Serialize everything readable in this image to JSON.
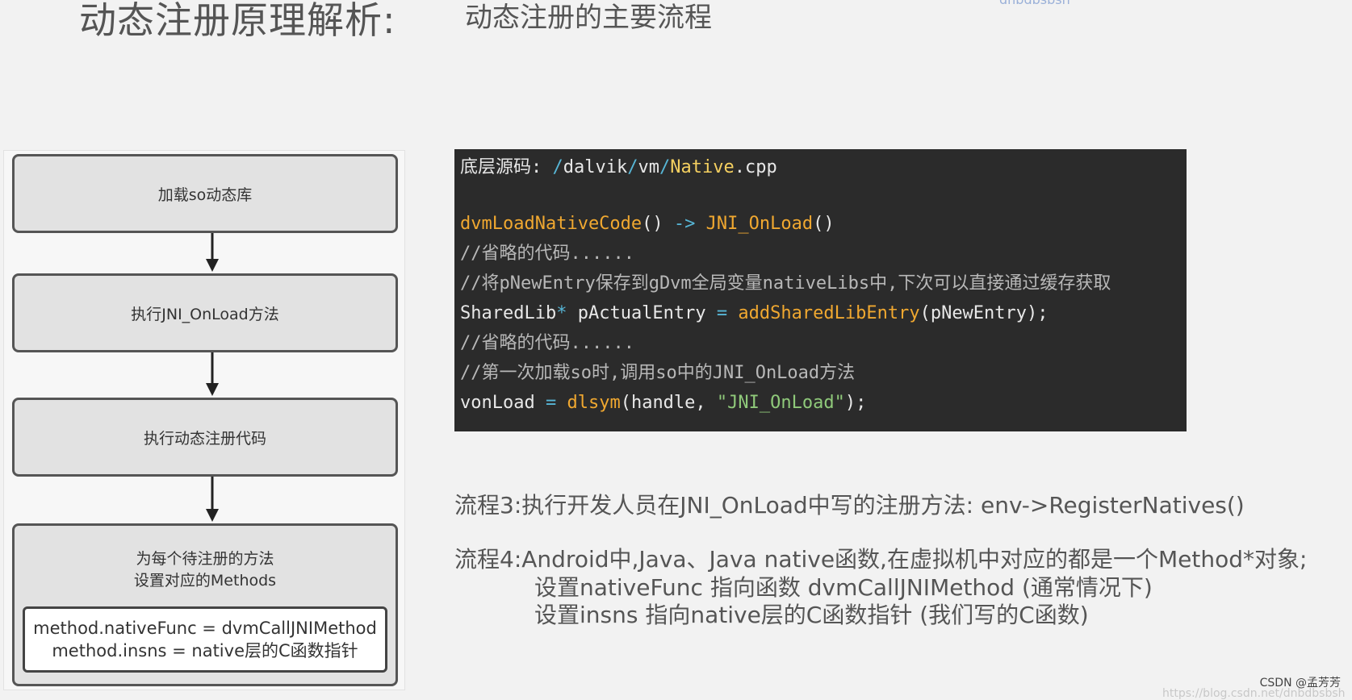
{
  "header": {
    "title": "动态注册原理解析:",
    "subtitle": "动态注册的主要流程",
    "faint_text": "dnbdbsbsh"
  },
  "flowchart": {
    "steps": [
      "加载so动态库",
      "执行JNI_OnLoad方法",
      "执行动态注册代码"
    ],
    "final_step_lines": [
      "为每个待注册的方法",
      "设置对应的Methods"
    ],
    "final_inner_lines": [
      "method.nativeFunc = dvmCallJNIMethod",
      "method.insns = native层的C函数指针"
    ]
  },
  "code": {
    "source_label": "底层源码: ",
    "path_slash1": "/",
    "path_dir1": "dalvik",
    "path_slash2": "/",
    "path_dir2": "vm",
    "path_slash3": "/",
    "path_file": "Native",
    "path_ext": ".cpp",
    "line1_fn1": "dvmLoadNativeCode",
    "line1_paren1": "()",
    "line1_arrow": " -> ",
    "line1_fn2": "JNI_OnLoad",
    "line1_paren2": "()",
    "comment1": "//省略的代码......",
    "comment2": "//将pNewEntry保存到gDvm全局变量nativeLibs中,下次可以直接通过缓存获取",
    "line4_type": "SharedLib",
    "line4_star": "*",
    "line4_var": " pActualEntry ",
    "line4_eq": "=",
    "line4_space": " ",
    "line4_fn": "addSharedLibEntry",
    "line4_args": "(pNewEntry);",
    "comment3": "//省略的代码......",
    "comment4": "//第一次加载so时,调用so中的JNI_OnLoad方法",
    "line7_var": "vonLoad ",
    "line7_eq": "=",
    "line7_space": " ",
    "line7_fn": "dlsym",
    "line7_args1": "(handle, ",
    "line7_str": "\"JNI_OnLoad\"",
    "line7_args2": ");"
  },
  "process": {
    "p3": "流程3:执行开发人员在JNI_OnLoad中写的注册方法: env->RegisterNatives()",
    "p4_line1": "流程4:Android中,Java、Java native函数,在虚拟机中对应的都是一个Method*对象;",
    "p4_line2": "设置nativeFunc 指向函数 dvmCallJNIMethod (通常情况下)",
    "p4_line3": "设置insns 指向native层的C函数指针 (我们写的C函数)"
  },
  "footer": {
    "watermark": "CSDN @孟芳芳",
    "faint_url": "https://blog.csdn.net/dnbdbsbsh"
  }
}
